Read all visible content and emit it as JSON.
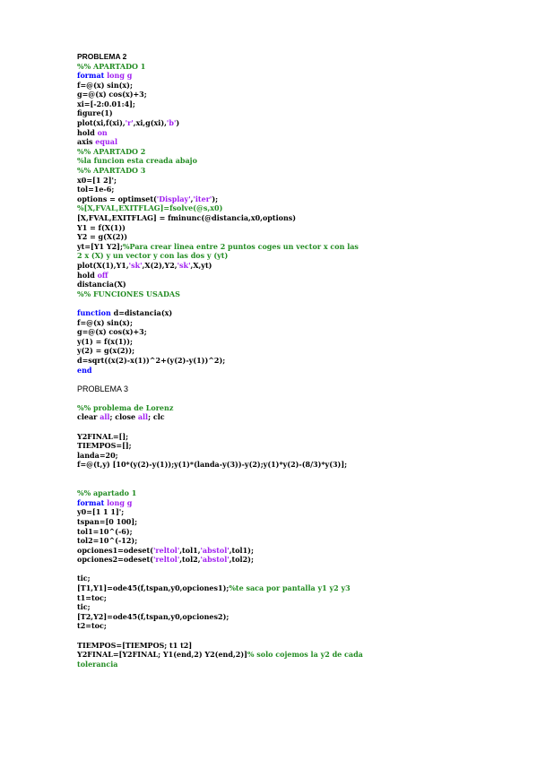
{
  "sections": [
    {
      "heading": "PROBLEMA 2",
      "lines": [
        [
          {
            "t": "c",
            "v": "%% APARTADO 1"
          }
        ],
        [
          {
            "t": "k",
            "v": "format "
          },
          {
            "t": "s",
            "v": "long g"
          }
        ],
        [
          {
            "t": "",
            "v": "f=@(x) sin(x);"
          }
        ],
        [
          {
            "t": "",
            "v": "g=@(x) cos(x)+3;"
          }
        ],
        [
          {
            "t": "",
            "v": "xi=[-2:0.01:4];"
          }
        ],
        [
          {
            "t": "",
            "v": "figure(1)"
          }
        ],
        [
          {
            "t": "",
            "v": "plot(xi,f(xi),"
          },
          {
            "t": "s",
            "v": "'r'"
          },
          {
            "t": "",
            "v": ",xi,g(xi),"
          },
          {
            "t": "s",
            "v": "'b'"
          },
          {
            "t": "",
            "v": ")"
          }
        ],
        [
          {
            "t": "",
            "v": "hold "
          },
          {
            "t": "s",
            "v": "on"
          }
        ],
        [
          {
            "t": "",
            "v": "axis "
          },
          {
            "t": "s",
            "v": "equal"
          }
        ],
        [
          {
            "t": "c",
            "v": "%% APARTADO 2"
          }
        ],
        [
          {
            "t": "c",
            "v": "%la funcion esta creada abajo"
          }
        ],
        [
          {
            "t": "c",
            "v": "%% APARTADO 3"
          }
        ],
        [
          {
            "t": "",
            "v": "x0=[1 2]';"
          }
        ],
        [
          {
            "t": "",
            "v": "tol=1e-6;"
          }
        ],
        [
          {
            "t": "",
            "v": "options = optimset("
          },
          {
            "t": "s",
            "v": "'Display'"
          },
          {
            "t": "",
            "v": ","
          },
          {
            "t": "s",
            "v": "'iter'"
          },
          {
            "t": "",
            "v": ");"
          }
        ],
        [
          {
            "t": "c",
            "v": "%[X,FVAL,EXITFLAG]=fsolve(@s,x0)"
          }
        ],
        [
          {
            "t": "",
            "v": "[X,FVAL,EXITFLAG] = fminunc(@distancia,x0,options)"
          }
        ],
        [
          {
            "t": "",
            "v": "Y1 = f(X(1))"
          }
        ],
        [
          {
            "t": "",
            "v": "Y2 = g(X(2))"
          }
        ],
        [
          {
            "t": "",
            "v": "yt=[Y1 Y2];"
          },
          {
            "t": "c",
            "v": "%Para crear linea entre 2 puntos coges un vector x con las"
          }
        ],
        [
          {
            "t": "c",
            "v": "2 x (X) y un vector y con las dos y (yt)"
          }
        ],
        [
          {
            "t": "",
            "v": "plot(X(1),Y1,"
          },
          {
            "t": "s",
            "v": "'sk'"
          },
          {
            "t": "",
            "v": ",X(2),Y2,"
          },
          {
            "t": "s",
            "v": "'sk'"
          },
          {
            "t": "",
            "v": ",X,yt)"
          }
        ],
        [
          {
            "t": "",
            "v": "hold "
          },
          {
            "t": "s",
            "v": "off"
          }
        ],
        [
          {
            "t": "",
            "v": "distancia(X)"
          }
        ],
        [
          {
            "t": "c",
            "v": "%% FUNCIONES USADAS"
          }
        ],
        [],
        [
          {
            "t": "k",
            "v": "function "
          },
          {
            "t": "",
            "v": "d=distancia(x)"
          }
        ],
        [
          {
            "t": "",
            "v": "f=@(x) sin(x);"
          }
        ],
        [
          {
            "t": "",
            "v": "g=@(x) cos(x)+3;"
          }
        ],
        [
          {
            "t": "",
            "v": "y(1) = f(x(1));"
          }
        ],
        [
          {
            "t": "",
            "v": "y(2) = g(x(2));"
          }
        ],
        [
          {
            "t": "",
            "v": "d=sqrt((x(2)-x(1))^2+(y(2)-y(1))^2);"
          }
        ],
        [
          {
            "t": "k",
            "v": "end"
          }
        ],
        []
      ]
    },
    {
      "heading": "PROBLEMA 3",
      "lines": [
        [],
        [
          {
            "t": "c",
            "v": "%% problema de Lorenz"
          }
        ],
        [
          {
            "t": "",
            "v": "clear "
          },
          {
            "t": "s",
            "v": "all"
          },
          {
            "t": "",
            "v": "; close "
          },
          {
            "t": "s",
            "v": "all"
          },
          {
            "t": "",
            "v": "; clc"
          }
        ],
        [],
        [
          {
            "t": "",
            "v": "Y2FINAL=[];"
          }
        ],
        [
          {
            "t": "",
            "v": "TIEMPOS=[];"
          }
        ],
        [
          {
            "t": "",
            "v": "landa=20;"
          }
        ],
        [
          {
            "t": "",
            "v": "f=@(t,y) [10*(y(2)-y(1));y(1)*(landa-y(3))-y(2);y(1)*y(2)-(8/3)*y(3)];"
          }
        ],
        [],
        [],
        [
          {
            "t": "c",
            "v": "%% apartado 1"
          }
        ],
        [
          {
            "t": "k",
            "v": "format "
          },
          {
            "t": "s",
            "v": "long g"
          }
        ],
        [
          {
            "t": "",
            "v": "y0=[1 1 1]';"
          }
        ],
        [
          {
            "t": "",
            "v": "tspan=[0 100];"
          }
        ],
        [
          {
            "t": "",
            "v": "tol1=10^(-6);"
          }
        ],
        [
          {
            "t": "",
            "v": "tol2=10^(-12);"
          }
        ],
        [
          {
            "t": "",
            "v": "opciones1=odeset("
          },
          {
            "t": "s",
            "v": "'reltol'"
          },
          {
            "t": "",
            "v": ",tol1,"
          },
          {
            "t": "s",
            "v": "'abstol'"
          },
          {
            "t": "",
            "v": ",tol1);"
          }
        ],
        [
          {
            "t": "",
            "v": "opciones2=odeset("
          },
          {
            "t": "s",
            "v": "'reltol'"
          },
          {
            "t": "",
            "v": ",tol2,"
          },
          {
            "t": "s",
            "v": "'abstol'"
          },
          {
            "t": "",
            "v": ",tol2);"
          }
        ],
        [],
        [
          {
            "t": "",
            "v": "tic;"
          }
        ],
        [
          {
            "t": "",
            "v": "[T1,Y1]=ode45(f,tspan,y0,opciones1);"
          },
          {
            "t": "c",
            "v": "%te saca por pantalla y1 y2 y3"
          }
        ],
        [
          {
            "t": "",
            "v": "t1=toc;"
          }
        ],
        [
          {
            "t": "",
            "v": "tic;"
          }
        ],
        [
          {
            "t": "",
            "v": "[T2,Y2]=ode45(f,tspan,y0,opciones2);"
          }
        ],
        [
          {
            "t": "",
            "v": "t2=toc;"
          }
        ],
        [],
        [
          {
            "t": "",
            "v": "TIEMPOS=[TIEMPOS; t1 t2]"
          }
        ],
        [
          {
            "t": "",
            "v": "Y2FINAL=[Y2FINAL; Y1(end,2) Y2(end,2)]"
          },
          {
            "t": "c",
            "v": "% solo cojemos la y2 de cada"
          }
        ],
        [
          {
            "t": "c",
            "v": "tolerancia"
          }
        ]
      ]
    }
  ]
}
